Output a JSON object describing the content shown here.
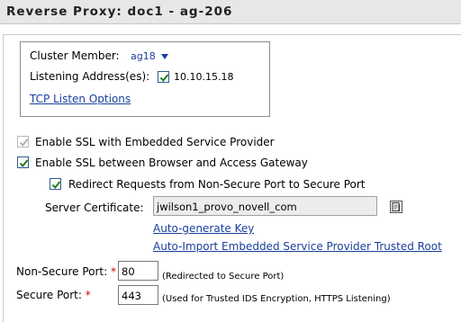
{
  "header": {
    "title": "Reverse Proxy: doc1 - ag-206"
  },
  "cluster": {
    "member_label": "Cluster Member:",
    "member_value": "ag18",
    "listening_label": "Listening Address(es):",
    "listening_value": "10.10.15.18",
    "listening_checked": true,
    "tcp_link": "TCP Listen Options"
  },
  "ssl": {
    "embedded_label": "Enable SSL with Embedded Service Provider",
    "embedded_checked": true,
    "embedded_disabled": true,
    "browser_label": "Enable SSL between Browser and Access Gateway",
    "browser_checked": true,
    "redirect_label": "Redirect Requests from Non-Secure Port to Secure Port",
    "redirect_checked": true
  },
  "certificate": {
    "label": "Server Certificate:",
    "value": "jwilson1_provo_novell_com",
    "autogen_link": "Auto-generate Key",
    "autoimport_link": "Auto-Import Embedded Service Provider Trusted Root"
  },
  "ports": {
    "nonsecure_label": "Non-Secure Port:",
    "nonsecure_value": "80",
    "nonsecure_note": "(Redirected to Secure Port)",
    "secure_label": "Secure Port:",
    "secure_value": "443",
    "secure_note": "(Used for Trusted IDS Encryption, HTTPS Listening)",
    "required_mark": "*"
  },
  "icons": {
    "dropdown": "triangle-down-icon",
    "certificate_picker": "certificate-picker-icon"
  },
  "colors": {
    "link": "#1a3e9c",
    "required": "#cc0000",
    "header_bg": "#e7e7e7"
  }
}
